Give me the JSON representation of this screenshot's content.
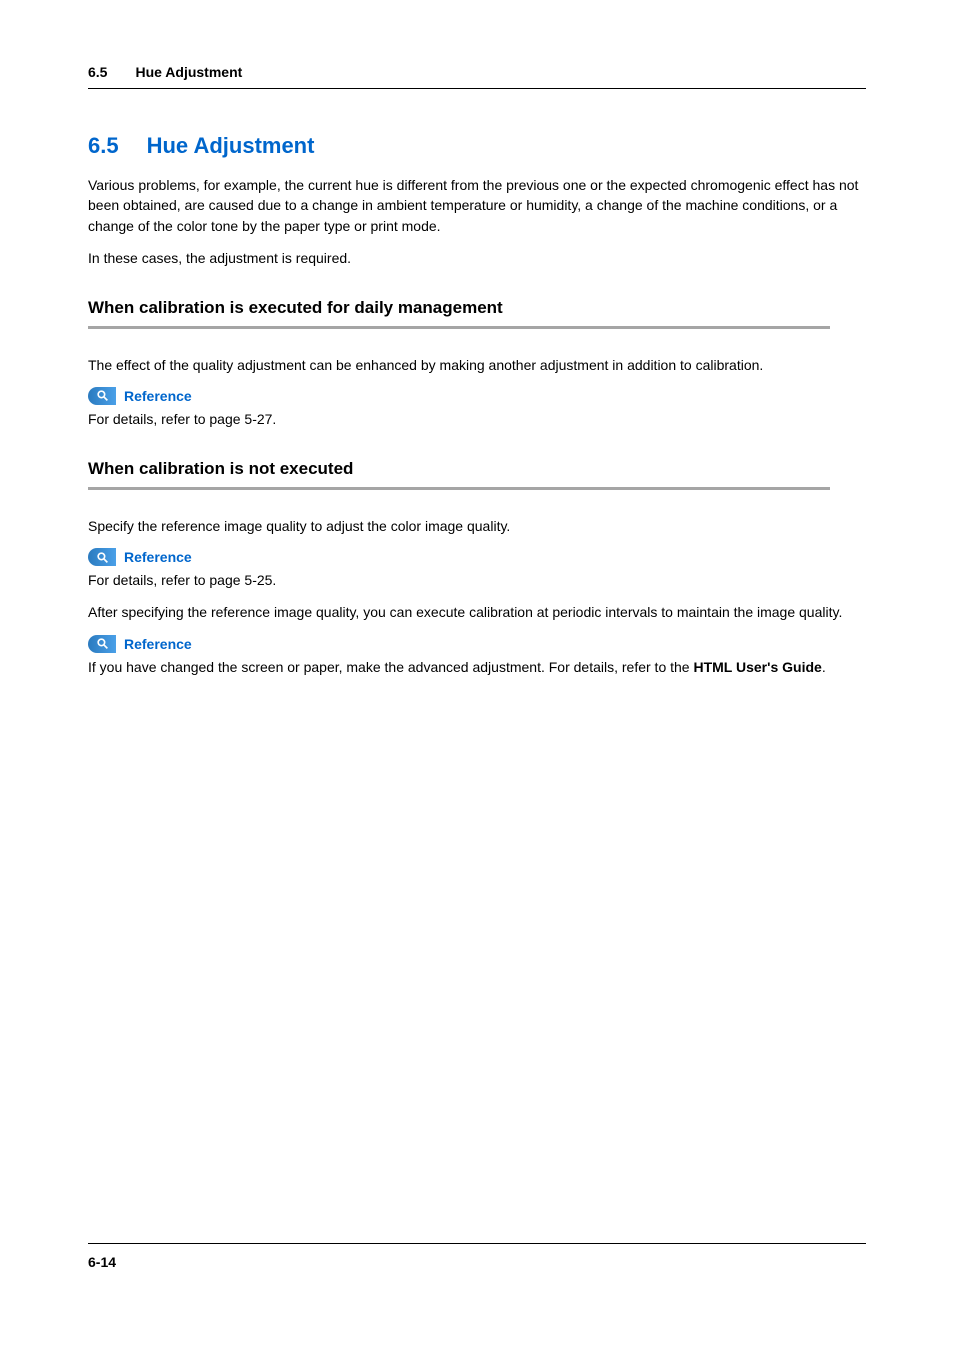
{
  "header": {
    "section_number": "6.5",
    "section_title": "Hue Adjustment"
  },
  "main": {
    "title_number": "6.5",
    "title_text": "Hue Adjustment",
    "intro_p1": "Various problems, for example, the current hue is different from the previous one or the expected chromogenic effect has not been obtained, are caused due to a change in ambient temperature or humidity, a change of the machine conditions, or a change of the color tone by the paper type or print mode.",
    "intro_p2": "In these cases, the adjustment is required.",
    "subsection1": {
      "title": "When calibration is executed for daily management",
      "p1": "The effect of the quality adjustment can be enhanced by making another adjustment in addition to calibration.",
      "reference1": {
        "label": "Reference",
        "text": "For details, refer to page 5-27."
      }
    },
    "subsection2": {
      "title": "When calibration is not executed",
      "p1": "Specify the reference image quality to adjust the color image quality.",
      "reference1": {
        "label": "Reference",
        "text": "For details, refer to page 5-25."
      },
      "p2": "After specifying the reference image quality, you can execute calibration at periodic intervals to maintain the image quality.",
      "reference2": {
        "label": "Reference",
        "text_prefix": "If you have changed the screen or paper, make the advanced adjustment. For details, refer to the ",
        "text_bold": "HTML User's Guide",
        "text_suffix": "."
      }
    }
  },
  "footer": {
    "page_number": "6-14"
  }
}
